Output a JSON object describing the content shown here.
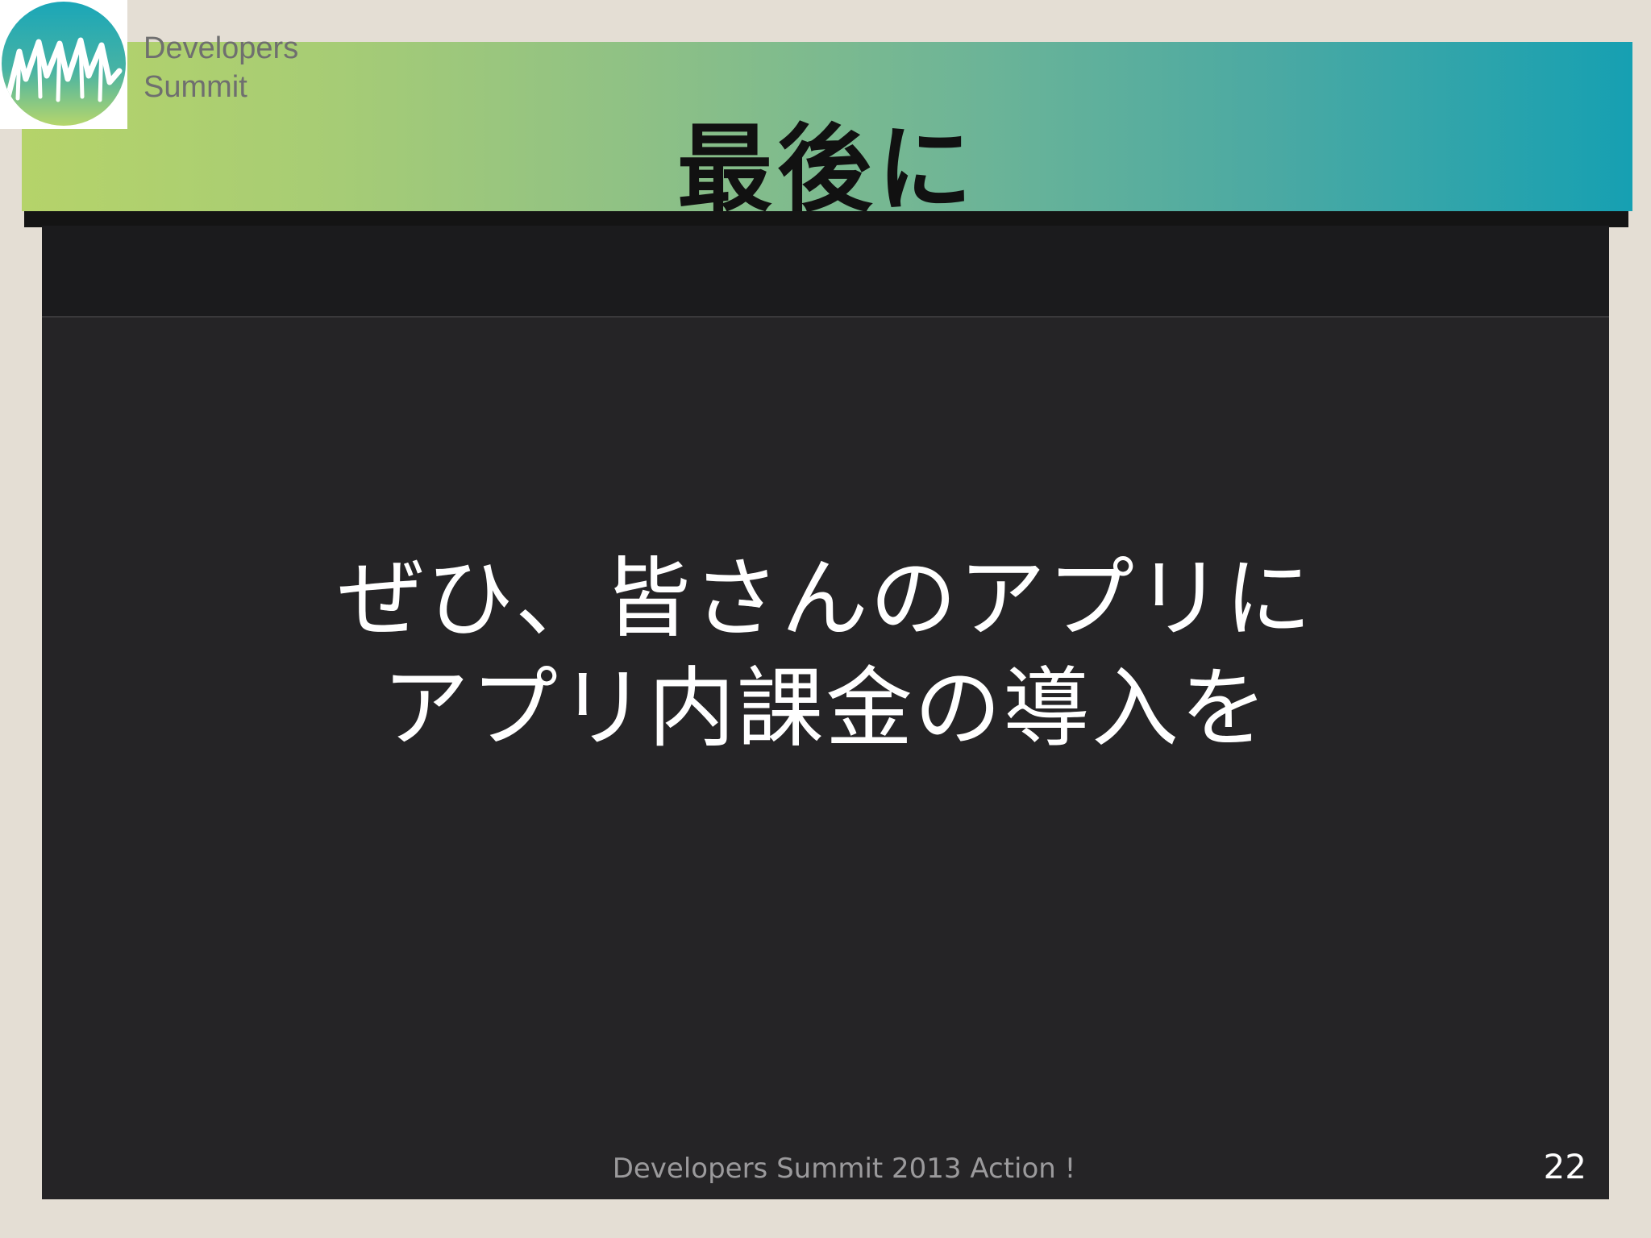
{
  "logo": {
    "line1": "Developers",
    "line2": "Summit",
    "icon": "mountain-logo-icon"
  },
  "slide": {
    "title": "最後に",
    "message_line1": "ぜひ、皆さんのアプリに",
    "message_line2": "アプリ内課金の導入を",
    "footer": "Developers Summit 2013 Action !",
    "page_number": "22"
  },
  "colors": {
    "background": "#e4ded4",
    "title_gradient_start": "#b5d36a",
    "title_gradient_end": "#16a0b2",
    "screen": "#252426",
    "message_text": "#ffffff"
  }
}
